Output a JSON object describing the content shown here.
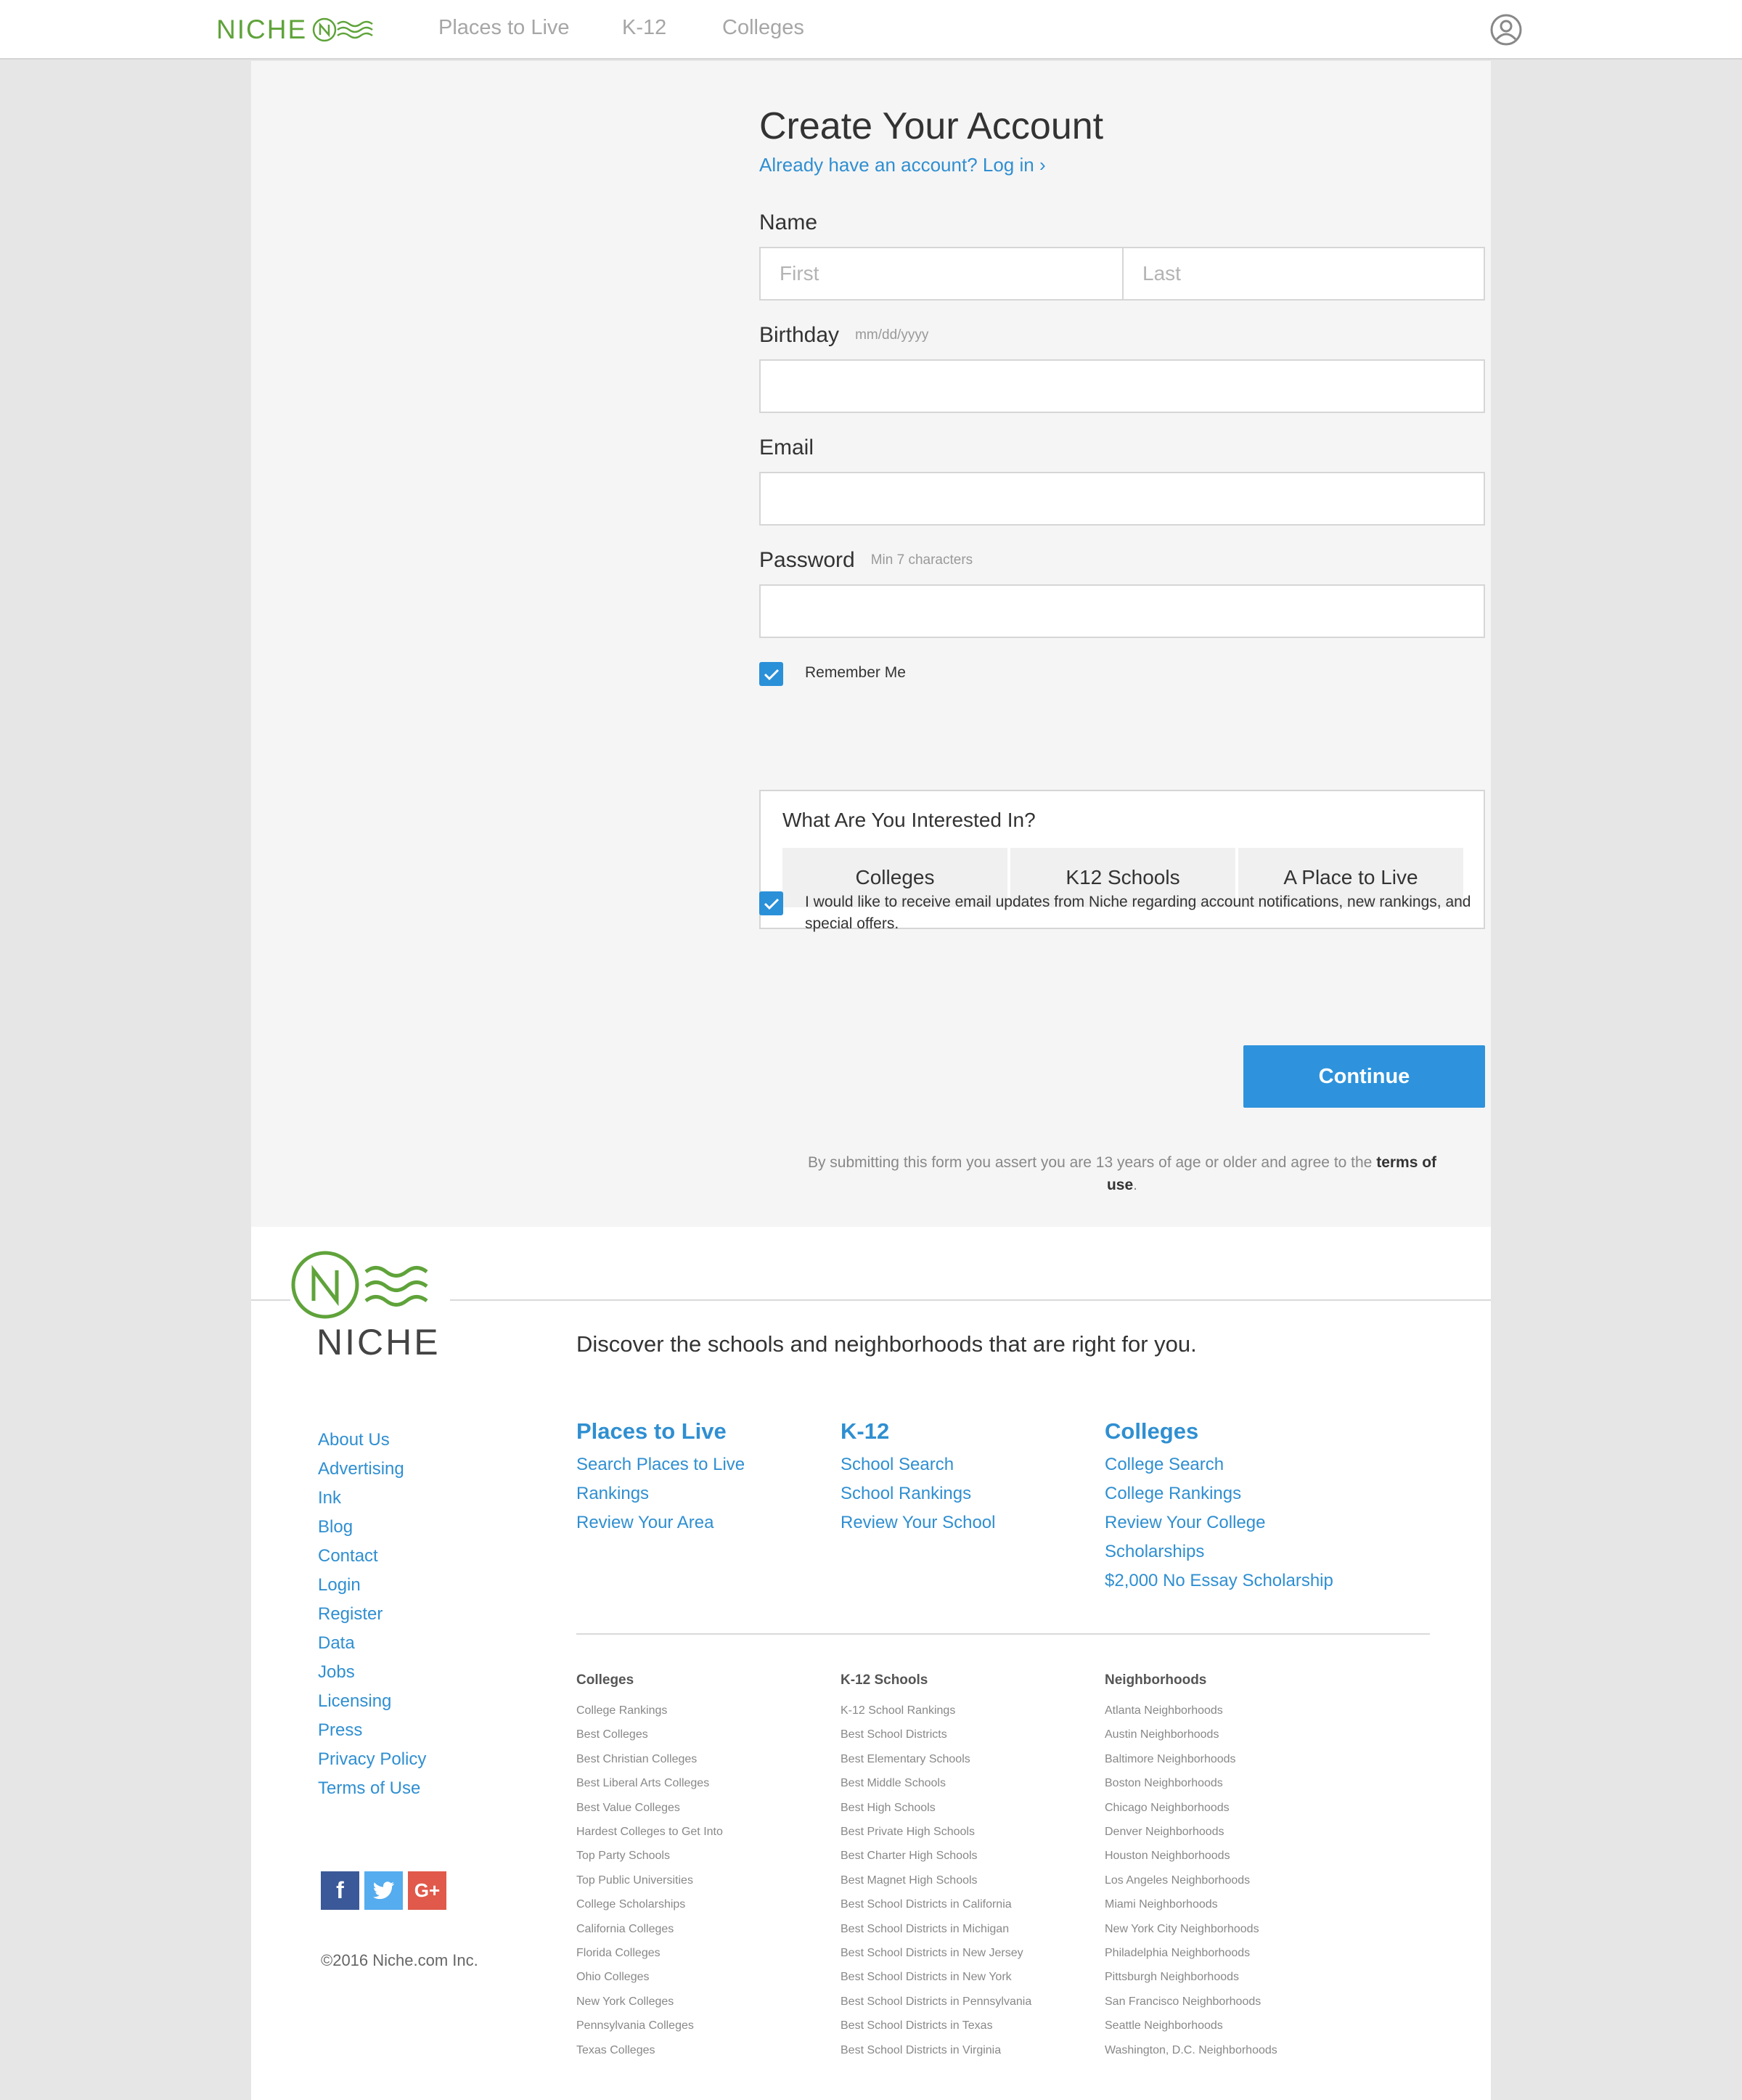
{
  "nav": {
    "logo_text": "NICHE",
    "links": [
      "Places to Live",
      "K-12",
      "Colleges"
    ]
  },
  "form": {
    "title": "Create Your Account",
    "login_link": "Already have an account? Log in ›",
    "name_label": "Name",
    "first_placeholder": "First",
    "last_placeholder": "Last",
    "birthday_label": "Birthday",
    "birthday_hint": "mm/dd/yyyy",
    "email_label": "Email",
    "password_label": "Password",
    "password_hint": "Min 7 characters",
    "remember_label": "Remember Me",
    "remember_checked": true,
    "interest_title": "What Are You Interested In?",
    "interest_options": [
      "Colleges",
      "K12 Schools",
      "A Place to Live"
    ],
    "email_updates_label": "I would like to receive email updates from Niche regarding account notifications, new rankings, and special offers.",
    "email_updates_checked": true,
    "continue_label": "Continue",
    "terms_prefix": "By submitting this form you assert you are 13 years of age or older and agree to the",
    "terms_link": "terms of use",
    "terms_suffix": "."
  },
  "footer": {
    "logo_text": "NICHE",
    "tagline": "Discover the schools and neighborhoods that are right for you.",
    "left_links": [
      "About Us",
      "Advertising",
      "Ink",
      "Blog",
      "Contact",
      "Login",
      "Register",
      "Data",
      "Jobs",
      "Licensing",
      "Press",
      "Privacy Policy",
      "Terms of Use"
    ],
    "categories": [
      {
        "title": "Places to Live",
        "links": [
          "Search Places to Live",
          "Rankings",
          "Review Your Area"
        ]
      },
      {
        "title": "K-12",
        "links": [
          "School Search",
          "School Rankings",
          "Review Your School"
        ]
      },
      {
        "title": "Colleges",
        "links": [
          "College Search",
          "College Rankings",
          "Review Your College",
          "Scholarships",
          "$2,000 No Essay Scholarship"
        ]
      }
    ],
    "small_columns": [
      {
        "title": "Colleges",
        "links": [
          "College Rankings",
          "Best Colleges",
          "Best Christian Colleges",
          "Best Liberal Arts Colleges",
          "Best Value Colleges",
          "Hardest Colleges to Get Into",
          "Top Party Schools",
          "Top Public Universities",
          "College Scholarships",
          "California Colleges",
          "Florida Colleges",
          "Ohio Colleges",
          "New York Colleges",
          "Pennsylvania Colleges",
          "Texas Colleges"
        ]
      },
      {
        "title": "K-12 Schools",
        "links": [
          "K-12 School Rankings",
          "Best School Districts",
          "Best Elementary Schools",
          "Best Middle Schools",
          "Best High Schools",
          "Best Private High Schools",
          "Best Charter High Schools",
          "Best Magnet High Schools",
          "Best School Districts in California",
          "Best School Districts in Michigan",
          "Best School Districts in New Jersey",
          "Best School Districts in New York",
          "Best School Districts in Pennsylvania",
          "Best School Districts in Texas",
          "Best School Districts in Virginia"
        ]
      },
      {
        "title": "Neighborhoods",
        "links": [
          "Atlanta Neighborhoods",
          "Austin Neighborhoods",
          "Baltimore Neighborhoods",
          "Boston Neighborhoods",
          "Chicago Neighborhoods",
          "Denver Neighborhoods",
          "Houston Neighborhoods",
          "Los Angeles Neighborhoods",
          "Miami Neighborhoods",
          "New York City Neighborhoods",
          "Philadelphia Neighborhoods",
          "Pittsburgh Neighborhoods",
          "San Francisco Neighborhoods",
          "Seattle Neighborhoods",
          "Washington, D.C. Neighborhoods"
        ]
      }
    ],
    "social": {
      "facebook": "f",
      "google": "G+"
    },
    "copyright": "©2016 Niche.com Inc."
  },
  "colors": {
    "accent": "#2e93dc",
    "brand_green": "#5fa33a",
    "link": "#2f8fd1"
  },
  "icons": [
    "niche-logo-icon",
    "user-account-icon",
    "eye-icon",
    "checkmark-icon",
    "facebook-icon",
    "twitter-icon",
    "google-plus-icon"
  ]
}
